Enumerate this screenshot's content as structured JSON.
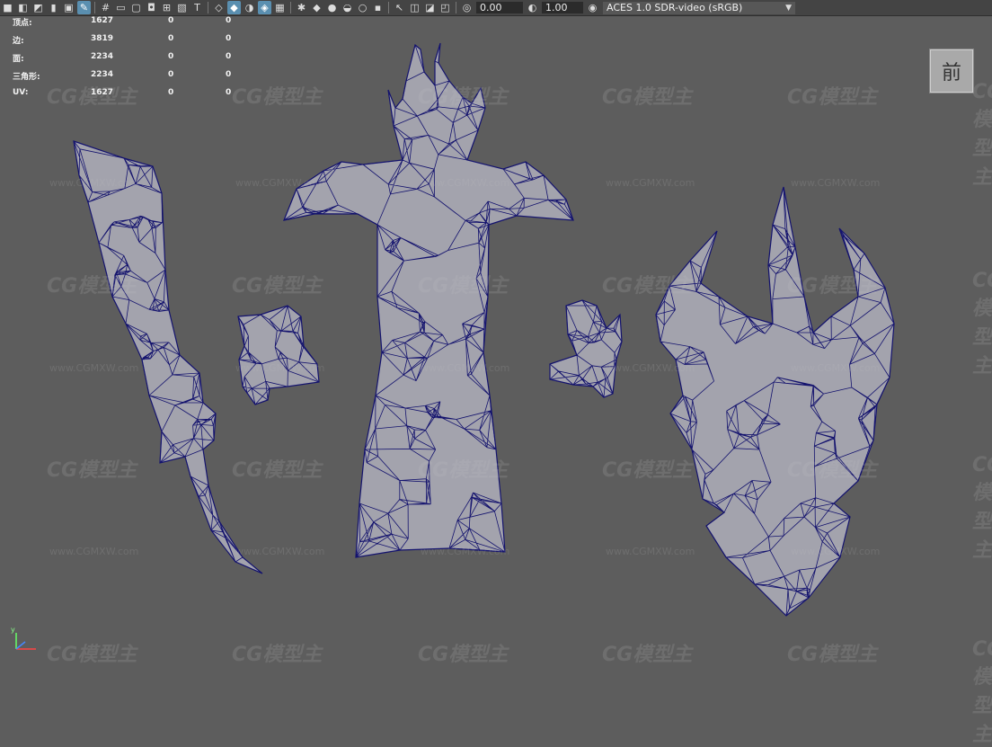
{
  "toolbar": {
    "icons": [
      "camera-icon",
      "camera-lock-icon",
      "camera-attributes-icon",
      "bookmark-icon",
      "image-plane-icon",
      "grease-pencil-icon",
      "grid-icon",
      "film-gate-icon",
      "resolution-gate-icon",
      "gate-mask-icon",
      "field-chart-icon",
      "safe-action-icon",
      "safe-title-icon",
      "wireframe-icon",
      "smooth-shade-icon",
      "default-material-icon",
      "wireframe-on-shaded-icon",
      "textured-icon",
      "use-all-lights-icon",
      "shadows-icon",
      "screen-space-ao-icon",
      "motion-blur-icon",
      "multisample-aa-icon",
      "depth-of-field-icon",
      "isolate-select-icon",
      "xray-icon",
      "xray-joints-icon",
      "xray-components-icon",
      "exposure-icon",
      "gamma-icon",
      "color-management-icon"
    ],
    "exposure_value": "0.00",
    "gamma_value": "1.00",
    "color_space": "ACES 1.0 SDR-video (sRGB)"
  },
  "hud": {
    "rows": [
      {
        "label": "顶点:",
        "v1": "1627",
        "v2": "0",
        "v3": "0"
      },
      {
        "label": "边:",
        "v1": "3819",
        "v2": "0",
        "v3": "0"
      },
      {
        "label": "面:",
        "v1": "2234",
        "v2": "0",
        "v3": "0"
      },
      {
        "label": "三角形:",
        "v1": "2234",
        "v2": "0",
        "v3": "0"
      },
      {
        "label": "UV:",
        "v1": "1627",
        "v2": "0",
        "v3": "0"
      }
    ]
  },
  "view_cube": {
    "label": "前"
  },
  "axis": {
    "y_label": "y"
  },
  "watermark": {
    "logo": "CG模型主",
    "url": "www.CGMXW.com"
  },
  "colors": {
    "viewport_bg": "#5d5d5d",
    "mesh_fill": "#a3a3ad",
    "wire": "#14136e",
    "toolbar_bg": "#444444",
    "active_icon": "#5a8fb0"
  }
}
